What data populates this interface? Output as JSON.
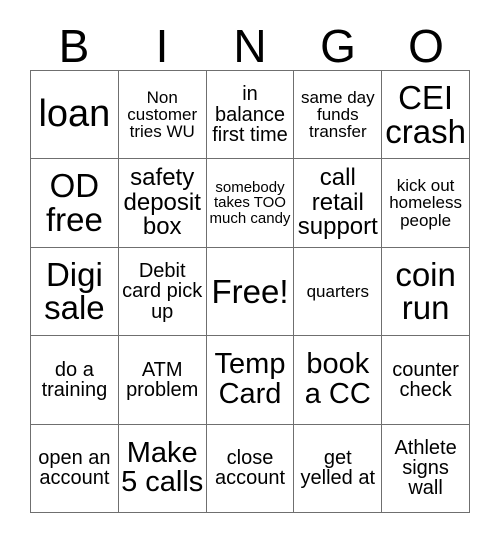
{
  "card": {
    "header_letters": [
      "B",
      "I",
      "N",
      "G",
      "O"
    ],
    "rows": [
      [
        {
          "text": "loan",
          "size": "xxl"
        },
        {
          "text": "Non customer tries WU",
          "size": "xs"
        },
        {
          "text": "in balance first time",
          "size": "sm"
        },
        {
          "text": "same day funds transfer",
          "size": "xs"
        },
        {
          "text": "CEI crash",
          "size": "xl"
        }
      ],
      [
        {
          "text": "OD free",
          "size": "xl"
        },
        {
          "text": "safety deposit box",
          "size": "md"
        },
        {
          "text": "somebody takes TOO much candy",
          "size": "xxs"
        },
        {
          "text": "call retail support",
          "size": "md"
        },
        {
          "text": "kick out homeless people",
          "size": "xs"
        }
      ],
      [
        {
          "text": "Digi sale",
          "size": "xl"
        },
        {
          "text": "Debit card pick up",
          "size": "sm"
        },
        {
          "text": "Free!",
          "size": "xl"
        },
        {
          "text": "quarters",
          "size": "xs"
        },
        {
          "text": "coin run",
          "size": "xl"
        }
      ],
      [
        {
          "text": "do a training",
          "size": "sm"
        },
        {
          "text": "ATM problem",
          "size": "sm"
        },
        {
          "text": "Temp Card",
          "size": "lg"
        },
        {
          "text": "book a CC",
          "size": "lg"
        },
        {
          "text": "counter check",
          "size": "sm"
        }
      ],
      [
        {
          "text": "open an account",
          "size": "sm"
        },
        {
          "text": "Make 5 calls",
          "size": "lg"
        },
        {
          "text": "close account",
          "size": "sm"
        },
        {
          "text": "get yelled at",
          "size": "sm"
        },
        {
          "text": "Athlete signs wall",
          "size": "sm"
        }
      ]
    ],
    "free_space": {
      "row": 2,
      "col": 2,
      "label": "Free!"
    },
    "colors": {
      "background": "#ffffff",
      "text": "#000000",
      "grid_line": "#6f6f6f"
    }
  }
}
